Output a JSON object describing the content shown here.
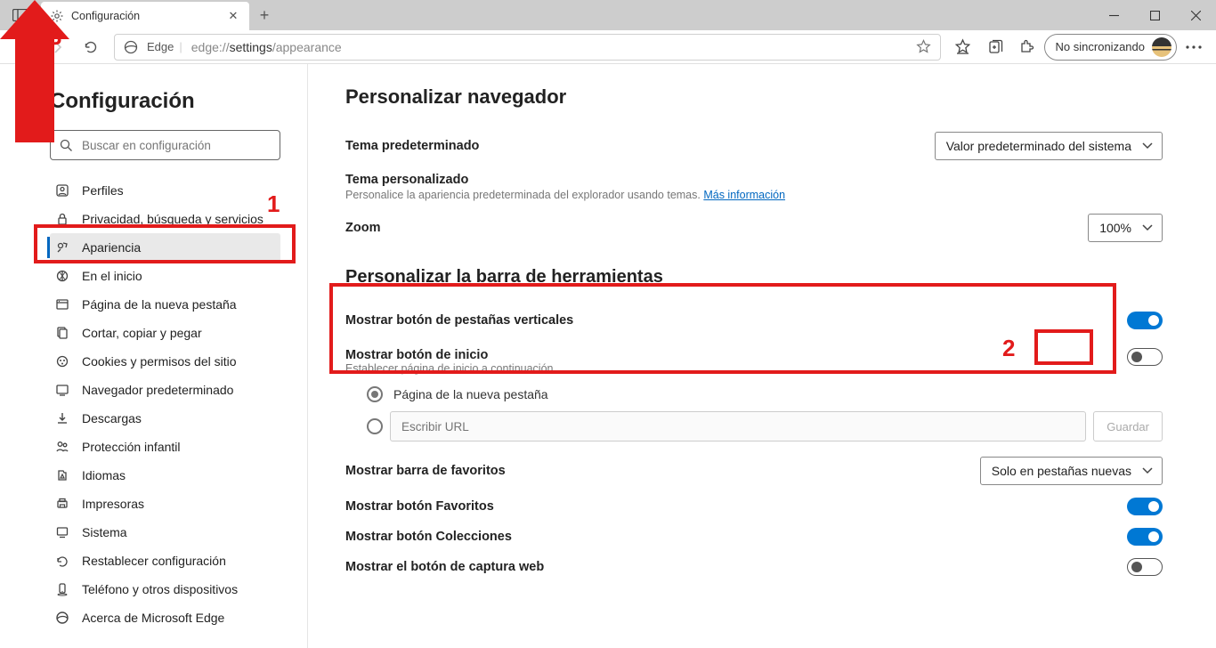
{
  "tab": {
    "title": "Configuración"
  },
  "url": {
    "scheme": "edge://",
    "path": "settings",
    "tail": "/appearance",
    "edge_label": "Edge"
  },
  "sync": {
    "label": "No sincronizando"
  },
  "sidebar": {
    "title": "Configuración",
    "search_placeholder": "Buscar en configuración",
    "items": [
      {
        "label": "Perfiles"
      },
      {
        "label": "Privacidad, búsqueda y servicios",
        "underline": true
      },
      {
        "label": "Apariencia",
        "active": true
      },
      {
        "label": "En el inicio"
      },
      {
        "label": "Página de la nueva pestaña"
      },
      {
        "label": "Cortar, copiar y pegar"
      },
      {
        "label": "Cookies y permisos del sitio"
      },
      {
        "label": "Navegador predeterminado"
      },
      {
        "label": "Descargas"
      },
      {
        "label": "Protección infantil"
      },
      {
        "label": "Idiomas"
      },
      {
        "label": "Impresoras"
      },
      {
        "label": "Sistema"
      },
      {
        "label": "Restablecer configuración"
      },
      {
        "label": "Teléfono y otros dispositivos"
      },
      {
        "label": "Acerca de Microsoft Edge"
      }
    ]
  },
  "main": {
    "h_customize_browser": "Personalizar navegador",
    "default_theme": {
      "label": "Tema predeterminado",
      "value": "Valor predeterminado del sistema"
    },
    "custom_theme": {
      "label": "Tema personalizado",
      "desc": "Personalice la apariencia predeterminada del explorador usando temas.",
      "link": "Más información"
    },
    "zoom": {
      "label": "Zoom",
      "value": "100%"
    },
    "h_toolbar": "Personalizar la barra de herramientas",
    "vertical_tabs": {
      "label": "Mostrar botón de pestañas verticales",
      "on": true
    },
    "home_button": {
      "label": "Mostrar botón de inicio",
      "hint": "Establecer página de inicio a continuación",
      "on": false
    },
    "radio_newtab": "Página de la nueva pestaña",
    "url_placeholder": "Escribir URL",
    "save": "Guardar",
    "favorites_bar": {
      "label": "Mostrar barra de favoritos",
      "value": "Solo en pestañas nuevas"
    },
    "show_fav_btn": {
      "label": "Mostrar botón Favoritos",
      "on": true
    },
    "show_coll_btn": {
      "label": "Mostrar botón Colecciones",
      "on": true
    },
    "show_capture_btn": {
      "label": "Mostrar el botón de captura web",
      "on": false
    }
  },
  "annotations": {
    "n1": "1",
    "n2": "2",
    "n3": "3"
  }
}
